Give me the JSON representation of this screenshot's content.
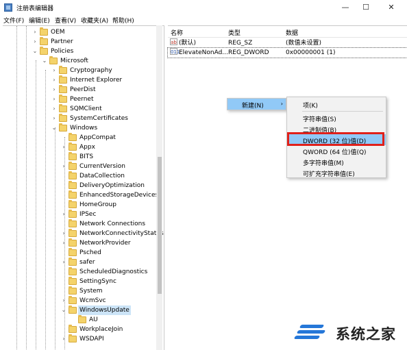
{
  "window": {
    "title": "注册表编辑器",
    "min_glyph": "—",
    "max_glyph": "☐",
    "close_glyph": "✕"
  },
  "menubar": [
    "文件(F)",
    "编辑(E)",
    "查看(V)",
    "收藏夹(A)",
    "帮助(H)"
  ],
  "tree": {
    "items": [
      {
        "label": "OEM",
        "chev": "›"
      },
      {
        "label": "Partner",
        "chev": "›"
      },
      {
        "label": "Policies",
        "chev": "⌄"
      },
      {
        "label": "Microsoft",
        "chev": "⌄"
      },
      {
        "label": "Cryptography",
        "chev": "›"
      },
      {
        "label": "Internet Explorer",
        "chev": "›"
      },
      {
        "label": "PeerDist",
        "chev": "›"
      },
      {
        "label": "Peernet",
        "chev": "›"
      },
      {
        "label": "SQMClient",
        "chev": "›"
      },
      {
        "label": "SystemCertificates",
        "chev": "›"
      },
      {
        "label": "Windows",
        "chev": "⌄"
      },
      {
        "label": "AppCompat",
        "chev": ""
      },
      {
        "label": "Appx",
        "chev": "›"
      },
      {
        "label": "BITS",
        "chev": ""
      },
      {
        "label": "CurrentVersion",
        "chev": "›"
      },
      {
        "label": "DataCollection",
        "chev": ""
      },
      {
        "label": "DeliveryOptimization",
        "chev": ""
      },
      {
        "label": "EnhancedStorageDevices",
        "chev": ""
      },
      {
        "label": "HomeGroup",
        "chev": ""
      },
      {
        "label": "IPSec",
        "chev": "›"
      },
      {
        "label": "Network Connections",
        "chev": ""
      },
      {
        "label": "NetworkConnectivityStatusIn",
        "chev": "›"
      },
      {
        "label": "NetworkProvider",
        "chev": "›"
      },
      {
        "label": "Psched",
        "chev": ""
      },
      {
        "label": "safer",
        "chev": "›"
      },
      {
        "label": "ScheduledDiagnostics",
        "chev": ""
      },
      {
        "label": "SettingSync",
        "chev": ""
      },
      {
        "label": "System",
        "chev": ""
      },
      {
        "label": "WcmSvc",
        "chev": "›"
      },
      {
        "label": "WindowsUpdate",
        "chev": "⌄",
        "selected": true
      },
      {
        "label": "AU",
        "chev": ""
      },
      {
        "label": "WorkplaceJoin",
        "chev": ""
      },
      {
        "label": "WSDAPI",
        "chev": "›"
      }
    ]
  },
  "list": {
    "headers": {
      "name": "名称",
      "type": "类型",
      "data": "数据"
    },
    "rows": [
      {
        "icon": "ab",
        "name": "(默认)",
        "type": "REG_SZ",
        "data": "(数值未设置)"
      },
      {
        "icon": "011",
        "name": "ElevateNonAd...",
        "type": "REG_DWORD",
        "data": "0x00000001 (1)"
      }
    ]
  },
  "context_menu": {
    "new_label": "新建(N)",
    "arrow": "›",
    "submenu": [
      {
        "label": "项(K)"
      },
      {
        "label": "字符串值(S)"
      },
      {
        "label": "二进制值(B)"
      },
      {
        "label": "DWORD (32 位)值(D)",
        "highlighted": true
      },
      {
        "label": "QWORD (64 位)值(Q)"
      },
      {
        "label": "多字符串值(M)"
      },
      {
        "label": "可扩充字符串值(E)"
      }
    ]
  },
  "watermark": {
    "text": "系统之家"
  },
  "colors": {
    "highlight": "#91c9f7",
    "red_box": "#e0201a",
    "folder": "#f4d36b"
  }
}
